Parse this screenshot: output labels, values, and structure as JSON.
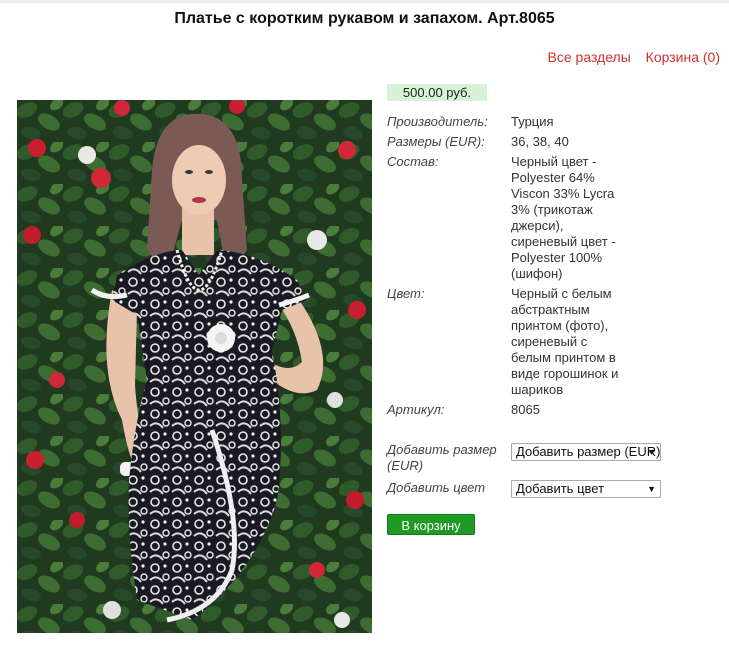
{
  "page_title": "Платье с коротким рукавом и запахом. Арт.8065",
  "top_links": {
    "all_sections": "Все разделы",
    "cart": "Корзина (0)"
  },
  "price": "500.00 руб.",
  "properties": [
    {
      "key": "Производитель:",
      "value": "Турция"
    },
    {
      "key": "Размеры (EUR):",
      "value": "36, 38, 40"
    },
    {
      "key": "Состав:",
      "value": "Черный цвет - Polyester 64% Viscon 33% Lycra 3% (трикотаж джерси), сиреневый цвет - Polyester 100% (шифон)"
    },
    {
      "key": "Цвет:",
      "value": "Черный с белым абстрактным принтом (фото), сиреневый с белым принтом в виде горошинок и шариков"
    },
    {
      "key": "Артикул:",
      "value": "8065"
    }
  ],
  "add_size": {
    "label": "Добавить размер (EUR)",
    "selected": "Добавить размер (EUR)"
  },
  "add_color": {
    "label": "Добавить цвет",
    "selected": "Добавить цвет"
  },
  "cart_button": "В корзину",
  "colors": {
    "link": "#d03030",
    "price_bg": "#d6f3d6",
    "button": "#1e9a25"
  }
}
